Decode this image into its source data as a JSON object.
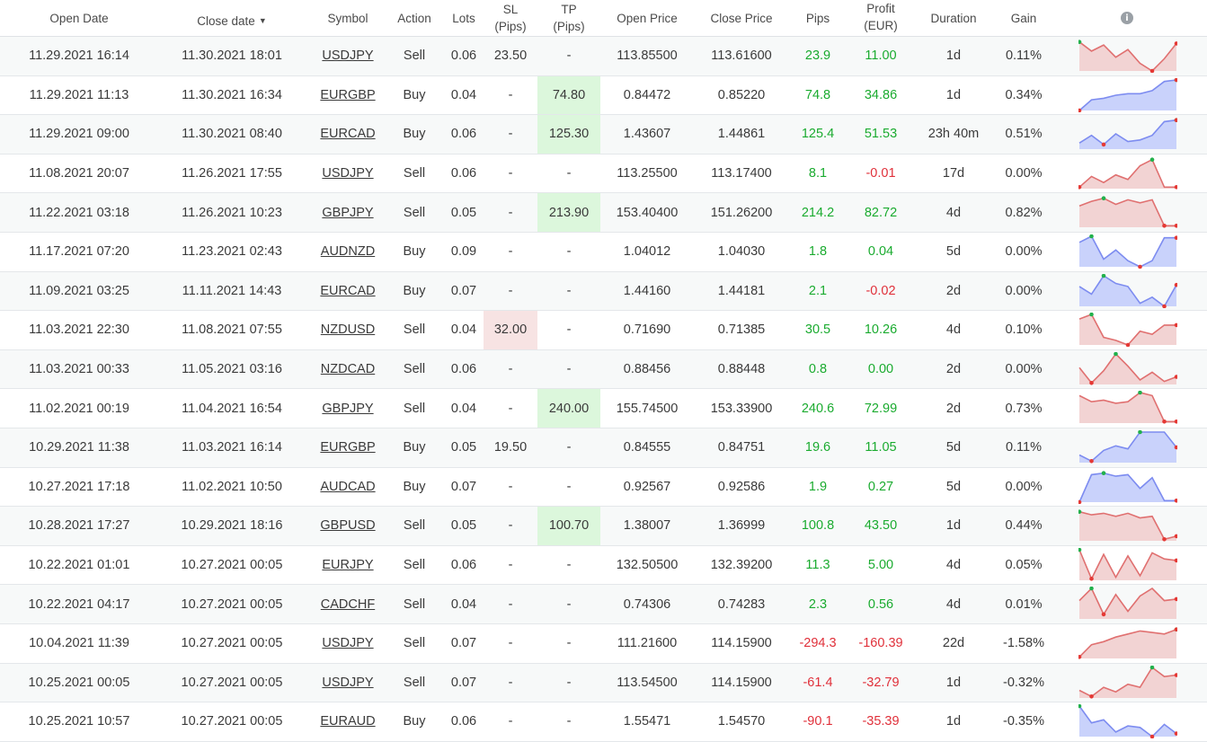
{
  "headers": {
    "open_date": "Open Date",
    "close_date": "Close date",
    "close_date_sort": "▼",
    "symbol": "Symbol",
    "action": "Action",
    "lots": "Lots",
    "sl_1": "SL",
    "sl_2": "(Pips)",
    "tp_1": "TP",
    "tp_2": "(Pips)",
    "open_price": "Open Price",
    "close_price": "Close Price",
    "pips": "Pips",
    "profit_1": "Profit",
    "profit_2": "(EUR)",
    "duration": "Duration",
    "gain": "Gain",
    "info_icon": "i"
  },
  "colors": {
    "positive": "#1aab2f",
    "negative": "#e0303a",
    "loss_fill": "#f2d3d3",
    "loss_line": "#e07070",
    "gain_fill": "#c9d2fb",
    "gain_line": "#7d8cf0",
    "tp_highlight": "#dcf7dc",
    "sl_highlight": "#f7e3e3"
  },
  "rows": [
    {
      "open": "11.29.2021 16:14",
      "close": "11.30.2021 18:01",
      "symbol": "USDJPY",
      "action": "Sell",
      "lots": "0.06",
      "sl": "23.50",
      "tp": "-",
      "open_price": "113.85500",
      "close_price": "113.61600",
      "pips": "23.9",
      "profit": "11.00",
      "duration": "1d",
      "gain": "0.11%",
      "pips_sign": "pos",
      "profit_sign": "pos",
      "tp_hl": false,
      "sl_hl": false,
      "spark": {
        "kind": "sell",
        "pts": [
          0.05,
          0.35,
          0.15,
          0.55,
          0.3,
          0.75,
          1.0,
          0.6,
          0.1
        ]
      }
    },
    {
      "open": "11.29.2021 11:13",
      "close": "11.30.2021 16:34",
      "symbol": "EURGBP",
      "action": "Buy",
      "lots": "0.04",
      "sl": "-",
      "tp": "74.80",
      "open_price": "0.84472",
      "close_price": "0.85220",
      "pips": "74.8",
      "profit": "34.86",
      "duration": "1d",
      "gain": "0.34%",
      "pips_sign": "pos",
      "profit_sign": "pos",
      "tp_hl": true,
      "sl_hl": false,
      "spark": {
        "kind": "buy",
        "pts": [
          1.0,
          0.65,
          0.6,
          0.5,
          0.45,
          0.45,
          0.35,
          0.05,
          0.0
        ]
      }
    },
    {
      "open": "11.29.2021 09:00",
      "close": "11.30.2021 08:40",
      "symbol": "EURCAD",
      "action": "Buy",
      "lots": "0.06",
      "sl": "-",
      "tp": "125.30",
      "open_price": "1.43607",
      "close_price": "1.44861",
      "pips": "125.4",
      "profit": "51.53",
      "duration": "23h 40m",
      "gain": "0.51%",
      "pips_sign": "pos",
      "profit_sign": "pos",
      "tp_hl": true,
      "sl_hl": false,
      "spark": {
        "kind": "buy",
        "pts": [
          0.8,
          0.55,
          0.85,
          0.5,
          0.75,
          0.7,
          0.55,
          0.1,
          0.05
        ]
      }
    },
    {
      "open": "11.08.2021 20:07",
      "close": "11.26.2021 17:55",
      "symbol": "USDJPY",
      "action": "Sell",
      "lots": "0.06",
      "sl": "-",
      "tp": "-",
      "open_price": "113.25500",
      "close_price": "113.17400",
      "pips": "8.1",
      "profit": "-0.01",
      "duration": "17d",
      "gain": "0.00%",
      "pips_sign": "pos",
      "profit_sign": "neg",
      "tp_hl": false,
      "sl_hl": false,
      "spark": {
        "kind": "sell",
        "pts": [
          0.95,
          0.6,
          0.8,
          0.55,
          0.7,
          0.25,
          0.05,
          0.95,
          0.95
        ]
      }
    },
    {
      "open": "11.22.2021 03:18",
      "close": "11.26.2021 10:23",
      "symbol": "GBPJPY",
      "action": "Sell",
      "lots": "0.05",
      "sl": "-",
      "tp": "213.90",
      "open_price": "153.40400",
      "close_price": "151.26200",
      "pips": "214.2",
      "profit": "82.72",
      "duration": "4d",
      "gain": "0.82%",
      "pips_sign": "pos",
      "profit_sign": "pos",
      "tp_hl": true,
      "sl_hl": false,
      "spark": {
        "kind": "sell",
        "pts": [
          0.3,
          0.15,
          0.05,
          0.25,
          0.1,
          0.2,
          0.1,
          0.95,
          0.95
        ]
      }
    },
    {
      "open": "11.17.2021 07:20",
      "close": "11.23.2021 02:43",
      "symbol": "AUDNZD",
      "action": "Buy",
      "lots": "0.09",
      "sl": "-",
      "tp": "-",
      "open_price": "1.04012",
      "close_price": "1.04030",
      "pips": "1.8",
      "profit": "0.04",
      "duration": "5d",
      "gain": "0.00%",
      "pips_sign": "pos",
      "profit_sign": "pos",
      "tp_hl": false,
      "sl_hl": false,
      "spark": {
        "kind": "buy",
        "pts": [
          0.2,
          0.0,
          0.75,
          0.45,
          0.8,
          1.0,
          0.8,
          0.05,
          0.05
        ]
      }
    },
    {
      "open": "11.09.2021 03:25",
      "close": "11.11.2021 14:43",
      "symbol": "EURCAD",
      "action": "Buy",
      "lots": "0.07",
      "sl": "-",
      "tp": "-",
      "open_price": "1.44160",
      "close_price": "1.44181",
      "pips": "2.1",
      "profit": "-0.02",
      "duration": "2d",
      "gain": "0.00%",
      "pips_sign": "pos",
      "profit_sign": "neg",
      "tp_hl": false,
      "sl_hl": false,
      "spark": {
        "kind": "buy",
        "pts": [
          0.35,
          0.6,
          0.0,
          0.25,
          0.35,
          0.9,
          0.7,
          1.0,
          0.3
        ]
      }
    },
    {
      "open": "11.03.2021 22:30",
      "close": "11.08.2021 07:55",
      "symbol": "NZDUSD",
      "action": "Sell",
      "lots": "0.04",
      "sl": "32.00",
      "tp": "-",
      "open_price": "0.71690",
      "close_price": "0.71385",
      "pips": "30.5",
      "profit": "10.26",
      "duration": "4d",
      "gain": "0.10%",
      "pips_sign": "pos",
      "profit_sign": "pos",
      "tp_hl": false,
      "sl_hl": true,
      "spark": {
        "kind": "sell",
        "pts": [
          0.15,
          0.0,
          0.75,
          0.85,
          1.0,
          0.55,
          0.65,
          0.35,
          0.35
        ]
      }
    },
    {
      "open": "11.03.2021 00:33",
      "close": "11.05.2021 03:16",
      "symbol": "NZDCAD",
      "action": "Sell",
      "lots": "0.06",
      "sl": "-",
      "tp": "-",
      "open_price": "0.88456",
      "close_price": "0.88448",
      "pips": "0.8",
      "profit": "0.00",
      "duration": "2d",
      "gain": "0.00%",
      "pips_sign": "pos",
      "profit_sign": "pos",
      "tp_hl": false,
      "sl_hl": false,
      "spark": {
        "kind": "sell",
        "pts": [
          0.45,
          0.95,
          0.55,
          0.0,
          0.4,
          0.85,
          0.6,
          0.9,
          0.75
        ]
      }
    },
    {
      "open": "11.02.2021 00:19",
      "close": "11.04.2021 16:54",
      "symbol": "GBPJPY",
      "action": "Sell",
      "lots": "0.04",
      "sl": "-",
      "tp": "240.00",
      "open_price": "155.74500",
      "close_price": "153.33900",
      "pips": "240.6",
      "profit": "72.99",
      "duration": "2d",
      "gain": "0.73%",
      "pips_sign": "pos",
      "profit_sign": "pos",
      "tp_hl": true,
      "sl_hl": false,
      "spark": {
        "kind": "sell",
        "pts": [
          0.1,
          0.3,
          0.25,
          0.35,
          0.3,
          0.0,
          0.1,
          0.95,
          0.95
        ]
      }
    },
    {
      "open": "10.29.2021 11:38",
      "close": "11.03.2021 16:14",
      "symbol": "EURGBP",
      "action": "Buy",
      "lots": "0.05",
      "sl": "19.50",
      "tp": "-",
      "open_price": "0.84555",
      "close_price": "0.84751",
      "pips": "19.6",
      "profit": "11.05",
      "duration": "5d",
      "gain": "0.11%",
      "pips_sign": "pos",
      "profit_sign": "pos",
      "tp_hl": false,
      "sl_hl": false,
      "spark": {
        "kind": "buy",
        "pts": [
          0.75,
          0.95,
          0.6,
          0.45,
          0.55,
          0.0,
          0.0,
          0.0,
          0.5
        ]
      }
    },
    {
      "open": "10.27.2021 17:18",
      "close": "11.02.2021 10:50",
      "symbol": "AUDCAD",
      "action": "Buy",
      "lots": "0.07",
      "sl": "-",
      "tp": "-",
      "open_price": "0.92567",
      "close_price": "0.92586",
      "pips": "1.9",
      "profit": "0.27",
      "duration": "5d",
      "gain": "0.00%",
      "pips_sign": "pos",
      "profit_sign": "pos",
      "tp_hl": false,
      "sl_hl": false,
      "spark": {
        "kind": "buy",
        "pts": [
          1.0,
          0.1,
          0.05,
          0.15,
          0.1,
          0.55,
          0.2,
          0.95,
          0.95
        ]
      }
    },
    {
      "open": "10.28.2021 17:27",
      "close": "10.29.2021 18:16",
      "symbol": "GBPUSD",
      "action": "Sell",
      "lots": "0.05",
      "sl": "-",
      "tp": "100.70",
      "open_price": "1.38007",
      "close_price": "1.36999",
      "pips": "100.8",
      "profit": "43.50",
      "duration": "1d",
      "gain": "0.44%",
      "pips_sign": "pos",
      "profit_sign": "pos",
      "tp_hl": true,
      "sl_hl": false,
      "spark": {
        "kind": "sell",
        "pts": [
          0.05,
          0.15,
          0.1,
          0.2,
          0.1,
          0.25,
          0.2,
          0.95,
          0.85
        ]
      }
    },
    {
      "open": "10.22.2021 01:01",
      "close": "10.27.2021 00:05",
      "symbol": "EURJPY",
      "action": "Sell",
      "lots": "0.06",
      "sl": "-",
      "tp": "-",
      "open_price": "132.50500",
      "close_price": "132.39200",
      "pips": "11.3",
      "profit": "5.00",
      "duration": "4d",
      "gain": "0.05%",
      "pips_sign": "pos",
      "profit_sign": "pos",
      "tp_hl": false,
      "sl_hl": false,
      "spark": {
        "kind": "sell",
        "pts": [
          0.0,
          0.95,
          0.15,
          0.9,
          0.2,
          0.85,
          0.1,
          0.3,
          0.35
        ]
      }
    },
    {
      "open": "10.22.2021 04:17",
      "close": "10.27.2021 00:05",
      "symbol": "CADCHF",
      "action": "Sell",
      "lots": "0.04",
      "sl": "-",
      "tp": "-",
      "open_price": "0.74306",
      "close_price": "0.74283",
      "pips": "2.3",
      "profit": "0.56",
      "duration": "4d",
      "gain": "0.01%",
      "pips_sign": "pos",
      "profit_sign": "pos",
      "tp_hl": false,
      "sl_hl": false,
      "spark": {
        "kind": "sell",
        "pts": [
          0.4,
          0.0,
          0.85,
          0.2,
          0.75,
          0.25,
          0.0,
          0.4,
          0.35
        ]
      }
    },
    {
      "open": "10.04.2021 11:39",
      "close": "10.27.2021 00:05",
      "symbol": "USDJPY",
      "action": "Sell",
      "lots": "0.07",
      "sl": "-",
      "tp": "-",
      "open_price": "111.21600",
      "close_price": "114.15900",
      "pips": "-294.3",
      "profit": "-160.39",
      "duration": "22d",
      "gain": "-1.58%",
      "pips_sign": "neg",
      "profit_sign": "neg",
      "tp_hl": false,
      "sl_hl": false,
      "spark": {
        "kind": "sell",
        "pts": [
          0.95,
          0.55,
          0.45,
          0.3,
          0.2,
          0.1,
          0.15,
          0.2,
          0.05
        ]
      }
    },
    {
      "open": "10.25.2021 00:05",
      "close": "10.27.2021 00:05",
      "symbol": "USDJPY",
      "action": "Sell",
      "lots": "0.07",
      "sl": "-",
      "tp": "-",
      "open_price": "113.54500",
      "close_price": "114.15900",
      "pips": "-61.4",
      "profit": "-32.79",
      "duration": "1d",
      "gain": "-0.32%",
      "pips_sign": "neg",
      "profit_sign": "neg",
      "tp_hl": false,
      "sl_hl": false,
      "spark": {
        "kind": "sell",
        "pts": [
          0.75,
          0.95,
          0.65,
          0.8,
          0.55,
          0.65,
          0.0,
          0.3,
          0.25
        ]
      }
    },
    {
      "open": "10.25.2021 10:57",
      "close": "10.27.2021 00:05",
      "symbol": "EURAUD",
      "action": "Buy",
      "lots": "0.06",
      "sl": "-",
      "tp": "-",
      "open_price": "1.55471",
      "close_price": "1.54570",
      "pips": "-90.1",
      "profit": "-35.39",
      "duration": "1d",
      "gain": "-0.35%",
      "pips_sign": "neg",
      "profit_sign": "neg",
      "tp_hl": false,
      "sl_hl": false,
      "spark": {
        "kind": "buy",
        "pts": [
          0.0,
          0.55,
          0.45,
          0.85,
          0.65,
          0.7,
          1.0,
          0.6,
          0.9
        ]
      }
    }
  ]
}
